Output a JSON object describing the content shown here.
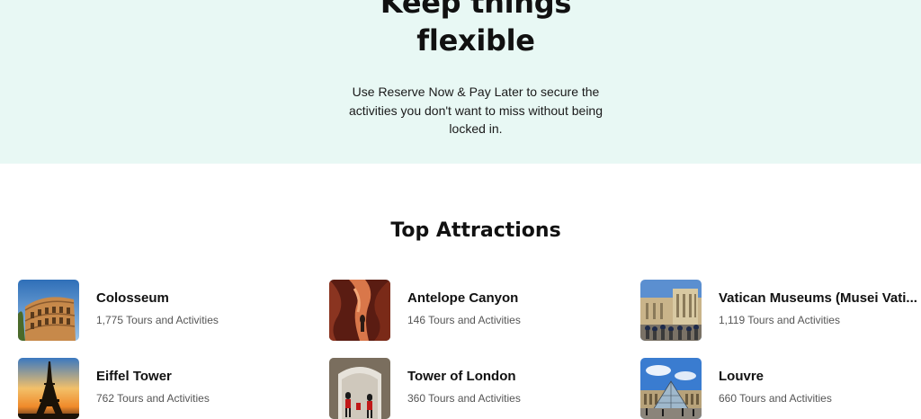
{
  "hero": {
    "title_line1": "Keep things",
    "title_line2": "flexible",
    "body_line1": "Use Reserve Now & Pay Later to secure the",
    "body_line2": "activities you don't want to miss without being",
    "body_line3": "locked in.",
    "background_color": "#e8f8f4"
  },
  "top_attractions": {
    "title": "Top Attractions",
    "items": [
      {
        "name": "Colosseum",
        "count": "1,775 Tours and Activities",
        "image": "colosseum-photo"
      },
      {
        "name": "Antelope Canyon",
        "count": "146 Tours and Activities",
        "image": "antelope-canyon-photo"
      },
      {
        "name": "Vatican Museums (Musei Vati...",
        "count": "1,119 Tours and Activities",
        "image": "vatican-museums-photo"
      },
      {
        "name": "Eiffel Tower",
        "count": "762 Tours and Activities",
        "image": "eiffel-tower-photo"
      },
      {
        "name": "Tower of London",
        "count": "360 Tours and Activities",
        "image": "tower-of-london-photo"
      },
      {
        "name": "Louvre",
        "count": "660 Tours and Activities",
        "image": "louvre-photo"
      }
    ]
  }
}
